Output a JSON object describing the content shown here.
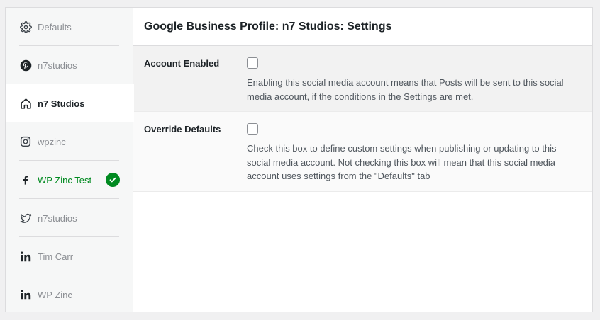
{
  "sidebar": {
    "tabs": [
      {
        "label": "Defaults",
        "icon": "gear-icon"
      },
      {
        "label": "n7studios",
        "icon": "pinterest-icon"
      },
      {
        "label": "n7 Studios",
        "icon": "home-icon",
        "active": true
      },
      {
        "label": "wpzinc",
        "icon": "instagram-icon"
      },
      {
        "label": "WP Zinc Test",
        "icon": "facebook-icon",
        "status": "connected"
      },
      {
        "label": "n7studios",
        "icon": "twitter-icon"
      },
      {
        "label": "Tim Carr",
        "icon": "linkedin-icon"
      },
      {
        "label": "WP Zinc",
        "icon": "linkedin-icon"
      }
    ]
  },
  "main": {
    "title": "Google Business Profile: n7 Studios: Settings",
    "settings": [
      {
        "label": "Account Enabled",
        "checked": false,
        "description": "Enabling this social media account means that Posts will be sent to this social media account, if the conditions in the Settings are met."
      },
      {
        "label": "Override Defaults",
        "checked": false,
        "description": "Check this box to define custom settings when publishing or updating to this social media account. Not checking this box will mean that this social media account uses settings from the \"Defaults\" tab"
      }
    ]
  },
  "colors": {
    "accent_green": "#008a20",
    "text_dark": "#1d2327",
    "text_muted": "#8c8f94"
  }
}
